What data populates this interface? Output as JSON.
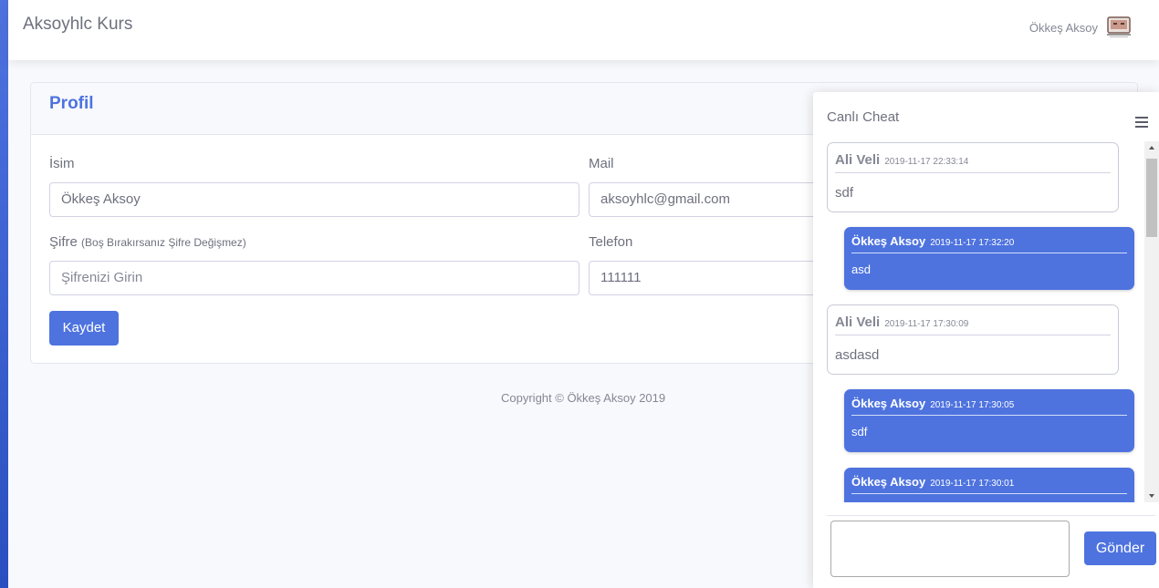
{
  "header": {
    "brand": "Aksoyhlc Kurs",
    "user_name": "Ökkeş Aksoy",
    "avatar_icon": "user-avatar-icon"
  },
  "profile": {
    "title": "Profil",
    "name_label": "İsim",
    "name_value": "Ökkeş Aksoy",
    "mail_label": "Mail",
    "mail_value": "aksoyhlc@gmail.com",
    "password_label": "Şifre",
    "password_hint": "(Boş Bırakırsanız Şifre Değişmez)",
    "password_placeholder": "Şifrenizi Girin",
    "phone_label": "Telefon",
    "phone_value": "111111",
    "save_label": "Kaydet"
  },
  "footer": {
    "copyright": "Copyright © Ökkeş Aksoy 2019"
  },
  "chat": {
    "title": "Canlı Cheat",
    "send_label": "Gönder",
    "input_value": "",
    "messages": [
      {
        "direction": "in",
        "name": "Ali Veli",
        "time": "2019-11-17 22:33:14",
        "text": "sdf"
      },
      {
        "direction": "out",
        "name": "Ökkeş Aksoy",
        "time": "2019-11-17 17:32:20",
        "text": "asd"
      },
      {
        "direction": "in",
        "name": "Ali Veli",
        "time": "2019-11-17 17:30:09",
        "text": "asdasd"
      },
      {
        "direction": "out",
        "name": "Ökkeş Aksoy",
        "time": "2019-11-17 17:30:05",
        "text": "sdf"
      },
      {
        "direction": "out",
        "name": "Ökkeş Aksoy",
        "time": "2019-11-17 17:30:01",
        "text": ""
      }
    ]
  },
  "colors": {
    "primary": "#4e73df",
    "text_muted": "#858796",
    "sidebar": "#4e73df"
  }
}
